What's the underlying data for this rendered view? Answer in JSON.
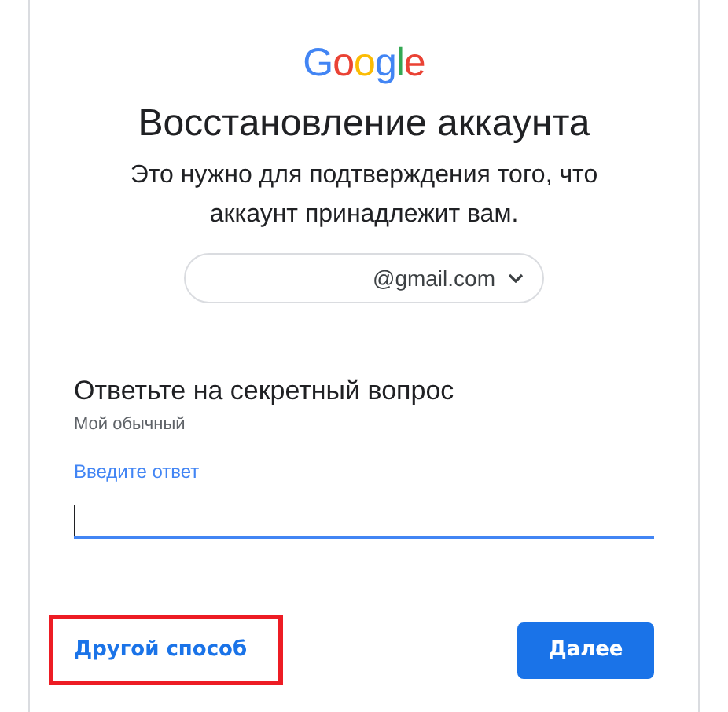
{
  "logo": "Google",
  "title": "Восстановление аккаунта",
  "subtitle": "Это нужно для подтверждения того, что аккаунт принадлежит вам.",
  "account_chip": {
    "email": "@gmail.com",
    "expanded": false
  },
  "section_heading": "Ответьте на секретный вопрос",
  "question": "Мой обычный",
  "answer_field": {
    "label": "Введите ответ",
    "focused": true
  },
  "alt_link": {
    "label": "Другой способ",
    "highlighted": true
  },
  "next_button": {
    "label": "Далее"
  }
}
